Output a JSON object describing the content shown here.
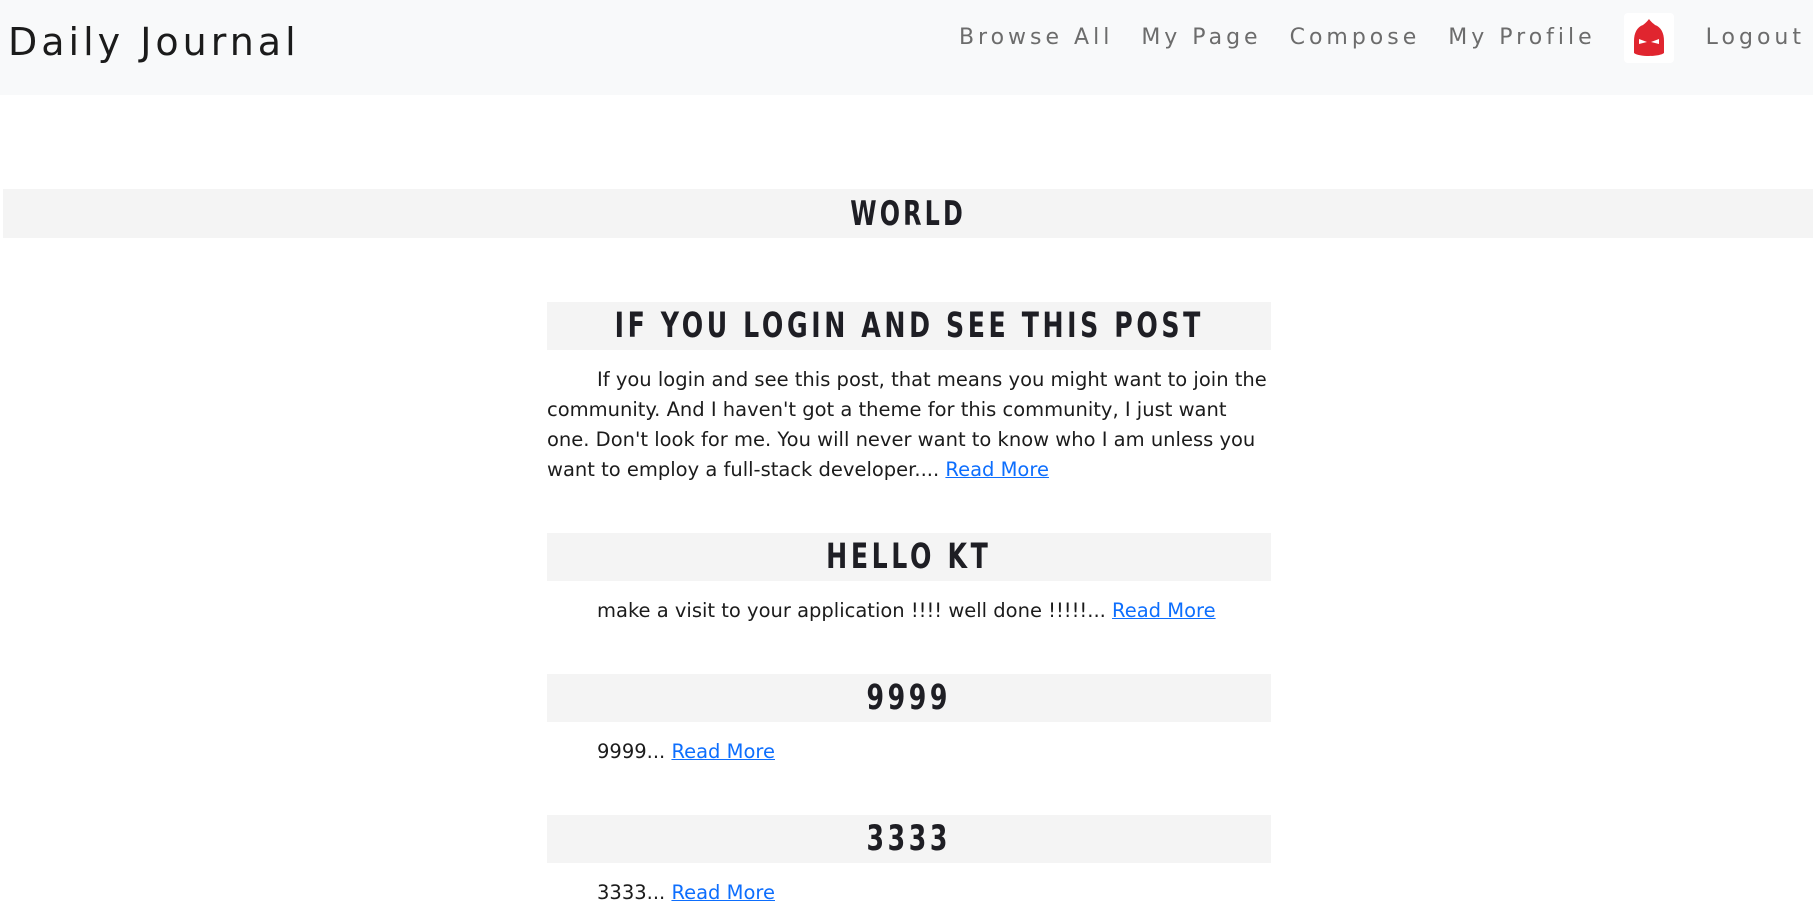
{
  "navbar": {
    "brand": "Daily Journal",
    "links": {
      "browse_all": "Browse All",
      "my_page": "My Page",
      "compose": "Compose",
      "my_profile": "My Profile",
      "logout": "Logout"
    },
    "avatar_icon": "red-helmet-icon"
  },
  "category": {
    "title": "WORLD"
  },
  "posts": [
    {
      "title": "IF YOU LOGIN AND SEE THIS POST",
      "excerpt": "If you login and see this post, that means you might want to join the community. And I haven't got a theme for this community, I just want one. Don't look for me. You will never want to know who I am unless you want to employ a full-stack developer....",
      "read_more": "Read More"
    },
    {
      "title": "HELLO KT",
      "excerpt": "make a visit to your application !!!! well done !!!!!...",
      "read_more": "Read More"
    },
    {
      "title": "9999",
      "excerpt": "9999...",
      "read_more": "Read More"
    },
    {
      "title": "3333",
      "excerpt": "3333...",
      "read_more": "Read More"
    }
  ],
  "colors": {
    "navbar_bg": "#f8f9fa",
    "title_bar_bg": "#f4f4f4",
    "link": "#0d6efd",
    "avatar_red": "#e0252f"
  }
}
